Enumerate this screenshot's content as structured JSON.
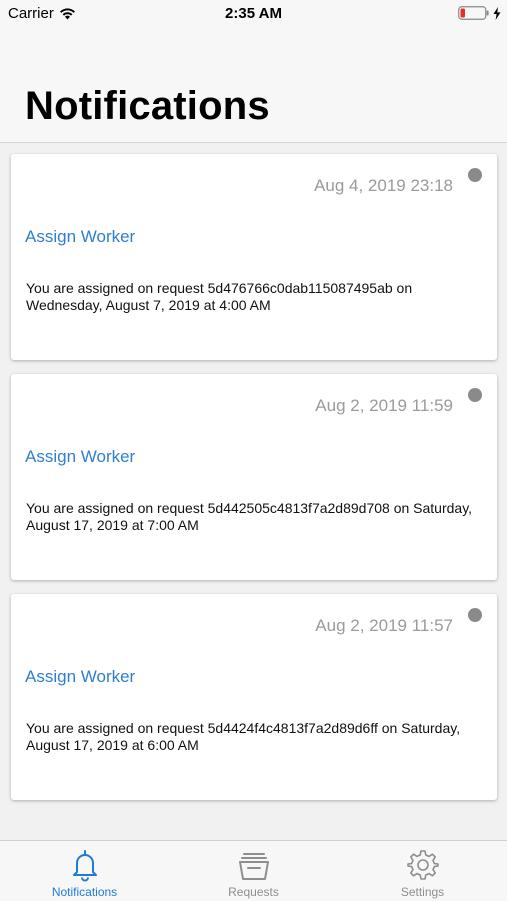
{
  "status_bar": {
    "carrier": "Carrier",
    "time": "2:35 AM",
    "wifi_icon": "wifi-icon",
    "battery_icon": "battery-low-icon",
    "charging_icon": "charging-bolt-icon",
    "battery_color": "#e0322a"
  },
  "header": {
    "title": "Notifications"
  },
  "notifications": [
    {
      "date": "Aug 4, 2019 23:18",
      "title": "Assign Worker",
      "body": "You are assigned on request  5d476766c0dab115087495ab on Wednesday, August 7, 2019 at 4:00 AM"
    },
    {
      "date": "Aug 2, 2019 11:59",
      "title": "Assign Worker",
      "body": "You are assigned on request  5d442505c4813f7a2d89d708 on Saturday, August 17, 2019 at 7:00 AM"
    },
    {
      "date": "Aug 2, 2019 11:57",
      "title": "Assign Worker",
      "body": "You are assigned on request  5d4424f4c4813f7a2d89d6ff on Saturday, August 17, 2019 at 6:00 AM"
    }
  ],
  "tabbar": {
    "tabs": [
      {
        "label": "Notifications",
        "icon": "bell-icon",
        "active": true
      },
      {
        "label": "Requests",
        "icon": "tray-icon",
        "active": false
      },
      {
        "label": "Settings",
        "icon": "gear-icon",
        "active": false
      }
    ]
  },
  "colors": {
    "accent": "#1f7ad9",
    "title_link": "#2f7fd0",
    "date_gray": "#9b9b9b",
    "unread_dot": "#8a8a8a"
  }
}
